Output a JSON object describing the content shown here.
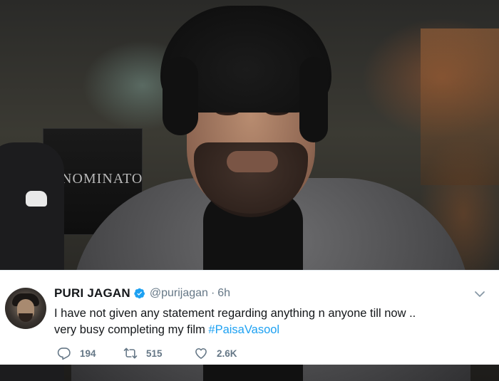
{
  "photo": {
    "shop_sign_text": "NOMINATO"
  },
  "tweet": {
    "author_name": "PURI JAGAN",
    "verified": true,
    "handle": "@purijagan",
    "separator": "·",
    "timestamp": "6h",
    "text_line1": "I have not given any statement regarding anything n anyone till now ..",
    "text_line2_prefix": "very busy completing my film ",
    "hashtag": "#PaisaVasool",
    "replies": "194",
    "retweets": "515",
    "likes": "2.6K",
    "icons": {
      "more": "chevron-down-icon",
      "reply": "reply-icon",
      "retweet": "retweet-icon",
      "like": "heart-icon",
      "verified": "verified-badge-icon"
    },
    "colors": {
      "link": "#1da1f2",
      "secondary_text": "#657786",
      "primary_text": "#14171a"
    }
  }
}
